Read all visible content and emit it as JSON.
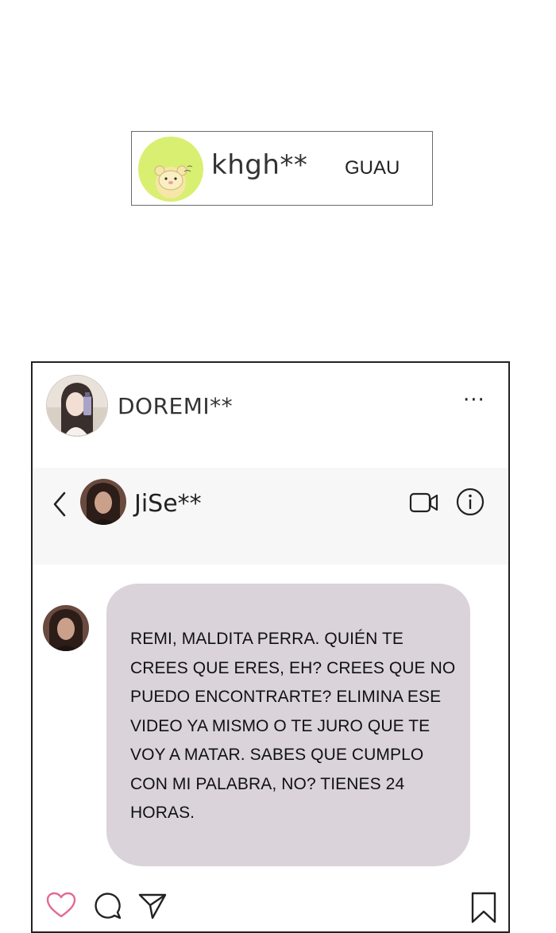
{
  "comment": {
    "username": "khgh**",
    "text": "GUAU",
    "avatar_icon": "bear-sticker-avatar",
    "avatar_bg": "#d9ef72"
  },
  "post": {
    "username": "DOREMI**",
    "more_label": "···",
    "avatar_icon": "girl-portrait-avatar",
    "dm": {
      "back_icon": "chevron-left-icon",
      "contact_name": "JiSe**",
      "contact_avatar_icon": "contact-portrait-avatar",
      "video_icon": "video-camera-icon",
      "info_icon": "info-icon"
    },
    "message": {
      "text": "REMI, MALDITA PERRA. QUIÉN TE CREES QUE ERES, EH? CREES QUE NO PUEDO ENCONTRARTE? ELIMINA ESE VIDEO YA MISMO O TE JURO QUE TE VOY A MATAR. SABES QUE CUMPLO CON MI PALABRA, NO? TIENES 24 HORAS.",
      "bubble_color": "#dad3da"
    },
    "actions": {
      "like_icon": "heart-icon",
      "like_color": "#e46a8e",
      "comment_icon": "comment-bubble-icon",
      "share_icon": "paper-plane-icon",
      "save_icon": "bookmark-icon"
    }
  }
}
